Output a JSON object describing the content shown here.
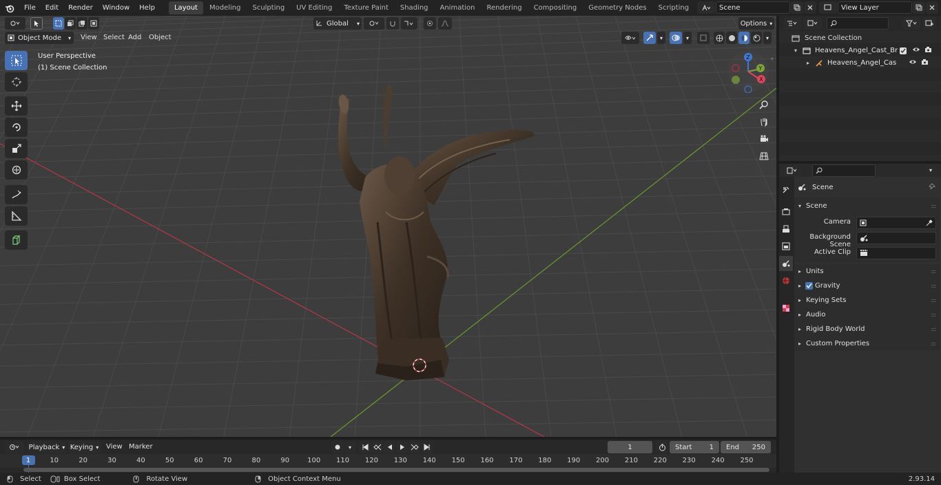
{
  "topbar": {
    "menus": [
      "File",
      "Edit",
      "Render",
      "Window",
      "Help"
    ],
    "workspaces": [
      "Layout",
      "Modeling",
      "Sculpting",
      "UV Editing",
      "Texture Paint",
      "Shading",
      "Animation",
      "Rendering",
      "Compositing",
      "Geometry Nodes",
      "Scripting"
    ],
    "active_workspace": "Layout",
    "add_tab": "+",
    "scene_name": "Scene",
    "view_layer": "View Layer"
  },
  "viewport": {
    "mode": "Object Mode",
    "menus": [
      "View",
      "Select",
      "Add",
      "Object"
    ],
    "transform_orientation": "Global",
    "options_label": "Options",
    "overlay_title": "User Perspective",
    "overlay_collection": "(1) Scene Collection",
    "gizmo": {
      "x": "X",
      "y": "Y",
      "z": "Z"
    }
  },
  "outliner": {
    "root": "Scene Collection",
    "collection": "Heavens_Angel_Cast_Bronze",
    "object": "Heavens_Angel_Cast_Br"
  },
  "properties": {
    "context": "Scene",
    "section": "Scene",
    "camera_label": "Camera",
    "background_scene_label": "Background Scene",
    "active_clip_label": "Active Clip",
    "panels": [
      "Units",
      "Gravity",
      "Keying Sets",
      "Audio",
      "Rigid Body World",
      "Custom Properties"
    ],
    "gravity_checked": true
  },
  "timeline": {
    "menus": [
      "Playback",
      "Keying",
      "View",
      "Marker"
    ],
    "current_frame": "1",
    "start_label": "Start",
    "start_value": "1",
    "end_label": "End",
    "end_value": "250",
    "ruler_ticks": [
      "1",
      "10",
      "20",
      "30",
      "40",
      "50",
      "60",
      "70",
      "80",
      "90",
      "100",
      "110",
      "120",
      "130",
      "140",
      "150",
      "160",
      "170",
      "180",
      "190",
      "200",
      "210",
      "220",
      "230",
      "240",
      "250"
    ]
  },
  "status": {
    "select": "Select",
    "box_select": "Box Select",
    "rotate_view": "Rotate View",
    "context_menu": "Object Context Menu",
    "version": "2.93.14"
  },
  "colors": {
    "accent": "#4772b3",
    "x_axis": "#b8364a",
    "y_axis": "#6b9a2c"
  }
}
